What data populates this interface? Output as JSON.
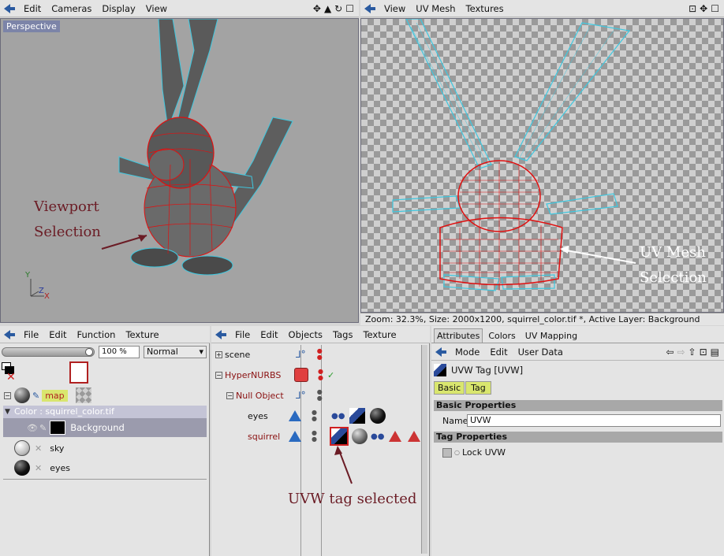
{
  "left_view": {
    "menu": [
      "Edit",
      "Cameras",
      "Display",
      "View"
    ],
    "label": "Perspective",
    "annotation_line1": "Viewport",
    "annotation_line2": "Selection",
    "axis": {
      "y": "Y",
      "z": "Z",
      "x": "X"
    }
  },
  "right_view": {
    "menu": [
      "View",
      "UV Mesh",
      "Textures"
    ],
    "annotation_line1": "UV Mesh",
    "annotation_line2": "Selection",
    "status": "Zoom: 32.3%, Size: 2000x1200, squirrel_color.tif *, Active Layer: Background"
  },
  "material_manager": {
    "menu": [
      "File",
      "Edit",
      "Function",
      "Texture"
    ],
    "zoom_value": "100 %",
    "blend_mode": "Normal",
    "material_name": "map",
    "channel_label": "Color : squirrel_color.tif",
    "layer_name": "Background",
    "materials": [
      "sky",
      "eyes"
    ]
  },
  "object_manager": {
    "menu": [
      "File",
      "Edit",
      "Objects",
      "Tags",
      "Texture"
    ],
    "objects": [
      {
        "name": "scene",
        "color": "#000000"
      },
      {
        "name": "HyperNURBS",
        "color": "#8a1010"
      },
      {
        "name": "Null Object",
        "color": "#8a1010"
      },
      {
        "name": "eyes",
        "color": "#000000"
      },
      {
        "name": "squirrel",
        "color": "#8a1010"
      }
    ],
    "annotation": "UVW tag selected"
  },
  "attributes": {
    "tabs": [
      "Attributes",
      "Colors",
      "UV Mapping"
    ],
    "menu": [
      "Mode",
      "Edit",
      "User Data"
    ],
    "title": "UVW Tag [UVW]",
    "subtabs": [
      "Basic",
      "Tag"
    ],
    "basic_header": "Basic Properties",
    "name_label": "Name",
    "name_value": "UVW",
    "tag_header": "Tag Properties",
    "lock_label": "Lock UVW"
  },
  "colors": {
    "accent": "#6b1c25",
    "wire_red": "#e01010",
    "wire_cyan": "#3ec8e0"
  }
}
